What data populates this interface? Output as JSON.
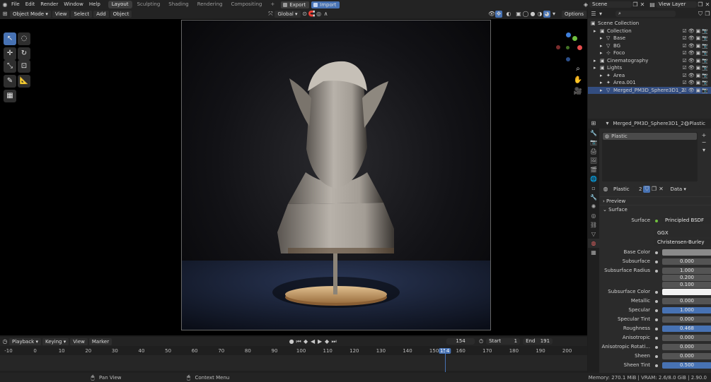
{
  "topbar": {
    "menus": [
      "File",
      "Edit",
      "Render",
      "Window",
      "Help"
    ],
    "workspace_tabs": [
      {
        "label": "Layout",
        "active": true
      },
      {
        "label": "Sculpting",
        "active": false
      },
      {
        "label": "Shading",
        "active": false
      },
      {
        "label": "Rendering",
        "active": false
      },
      {
        "label": "Compositing",
        "active": false
      }
    ],
    "add_tab": "+",
    "export_label": "Export",
    "import_label": "Import",
    "scene_name": "Scene",
    "view_layer": "View Layer"
  },
  "viewport_header": {
    "mode": "Object Mode",
    "menus": [
      "View",
      "Select",
      "Add",
      "Object"
    ],
    "transform_orientation": "Global",
    "options_label": "Options"
  },
  "gizmo": {
    "x_label": "X",
    "y_label": "Y",
    "z_label": "Z"
  },
  "outliner": {
    "title": "Scene Collection",
    "rows": [
      {
        "label": "Collection",
        "indent": 1,
        "icon": "collection-icon",
        "selected": false
      },
      {
        "label": "Base",
        "indent": 2,
        "icon": "mesh-icon",
        "selected": false
      },
      {
        "label": "BG",
        "indent": 2,
        "icon": "mesh-icon",
        "selected": false
      },
      {
        "label": "Foco",
        "indent": 2,
        "icon": "empty-icon",
        "selected": false
      },
      {
        "label": "Cinematography",
        "indent": 1,
        "icon": "collection-icon",
        "selected": false
      },
      {
        "label": "Lights",
        "indent": 1,
        "icon": "collection-icon",
        "selected": false
      },
      {
        "label": "Area",
        "indent": 2,
        "icon": "light-icon",
        "selected": false
      },
      {
        "label": "Area.001",
        "indent": 2,
        "icon": "light-icon",
        "selected": false
      },
      {
        "label": "Merged_PM3D_Sphere3D1_2",
        "indent": 2,
        "icon": "mesh-icon",
        "selected": true
      }
    ]
  },
  "properties": {
    "object_name": "Merged_PM3D_Sphere3D1_2",
    "material_name": "Plastic",
    "slot_label": "Plastic",
    "material_field": "Plastic",
    "user_count": "2",
    "link_mode": "Data",
    "preview_label": "Preview",
    "surface_section": "Surface",
    "surface_label": "Surface",
    "surface_value": "Principled BSDF",
    "distribution": "GGX",
    "subsurface_method": "Christensen-Burley",
    "rows": [
      {
        "label": "Base Color",
        "value": "",
        "style": "color-gray"
      },
      {
        "label": "Subsurface",
        "value": "0.000",
        "style": "num"
      },
      {
        "label": "Subsurface Radius",
        "value": "1.000",
        "style": "num"
      },
      {
        "label": "",
        "value": "0.200",
        "style": "num"
      },
      {
        "label": "",
        "value": "0.100",
        "style": "num"
      },
      {
        "label": "Subsurface Color",
        "value": "",
        "style": "color-white"
      },
      {
        "label": "Metallic",
        "value": "0.000",
        "style": "num"
      },
      {
        "label": "Specular",
        "value": "1.000",
        "style": "blue"
      },
      {
        "label": "Specular Tint",
        "value": "0.000",
        "style": "num"
      },
      {
        "label": "Roughness",
        "value": "0.468",
        "style": "blue"
      },
      {
        "label": "Anisotropic",
        "value": "0.000",
        "style": "num"
      },
      {
        "label": "Anisotropic Rotati...",
        "value": "0.000",
        "style": "num"
      },
      {
        "label": "Sheen",
        "value": "0.000",
        "style": "num"
      },
      {
        "label": "Sheen Tint",
        "value": "0.500",
        "style": "blue"
      }
    ]
  },
  "timeline": {
    "menus": [
      "Playback",
      "Keying",
      "View",
      "Marker"
    ],
    "current_frame": "154",
    "start_label": "Start",
    "start_value": "1",
    "end_label": "End",
    "end_value": "191",
    "ruler_ticks": [
      "-10",
      "0",
      "10",
      "20",
      "30",
      "40",
      "50",
      "60",
      "70",
      "80",
      "90",
      "100",
      "110",
      "120",
      "130",
      "140",
      "150",
      "154",
      "160",
      "170",
      "180",
      "190",
      "200"
    ]
  },
  "statusbar": {
    "pan_view": "Pan View",
    "context_menu": "Context Menu",
    "memory": "Memory: 270.1 MiB | VRAM: 2.6/8.0 GiB | 2.90.0"
  },
  "colors": {
    "accent": "#4772b3",
    "selected_row": "#334d80",
    "x_axis": "#e34c4c",
    "y_axis": "#6fbf3f",
    "z_axis": "#3f7fdc"
  }
}
